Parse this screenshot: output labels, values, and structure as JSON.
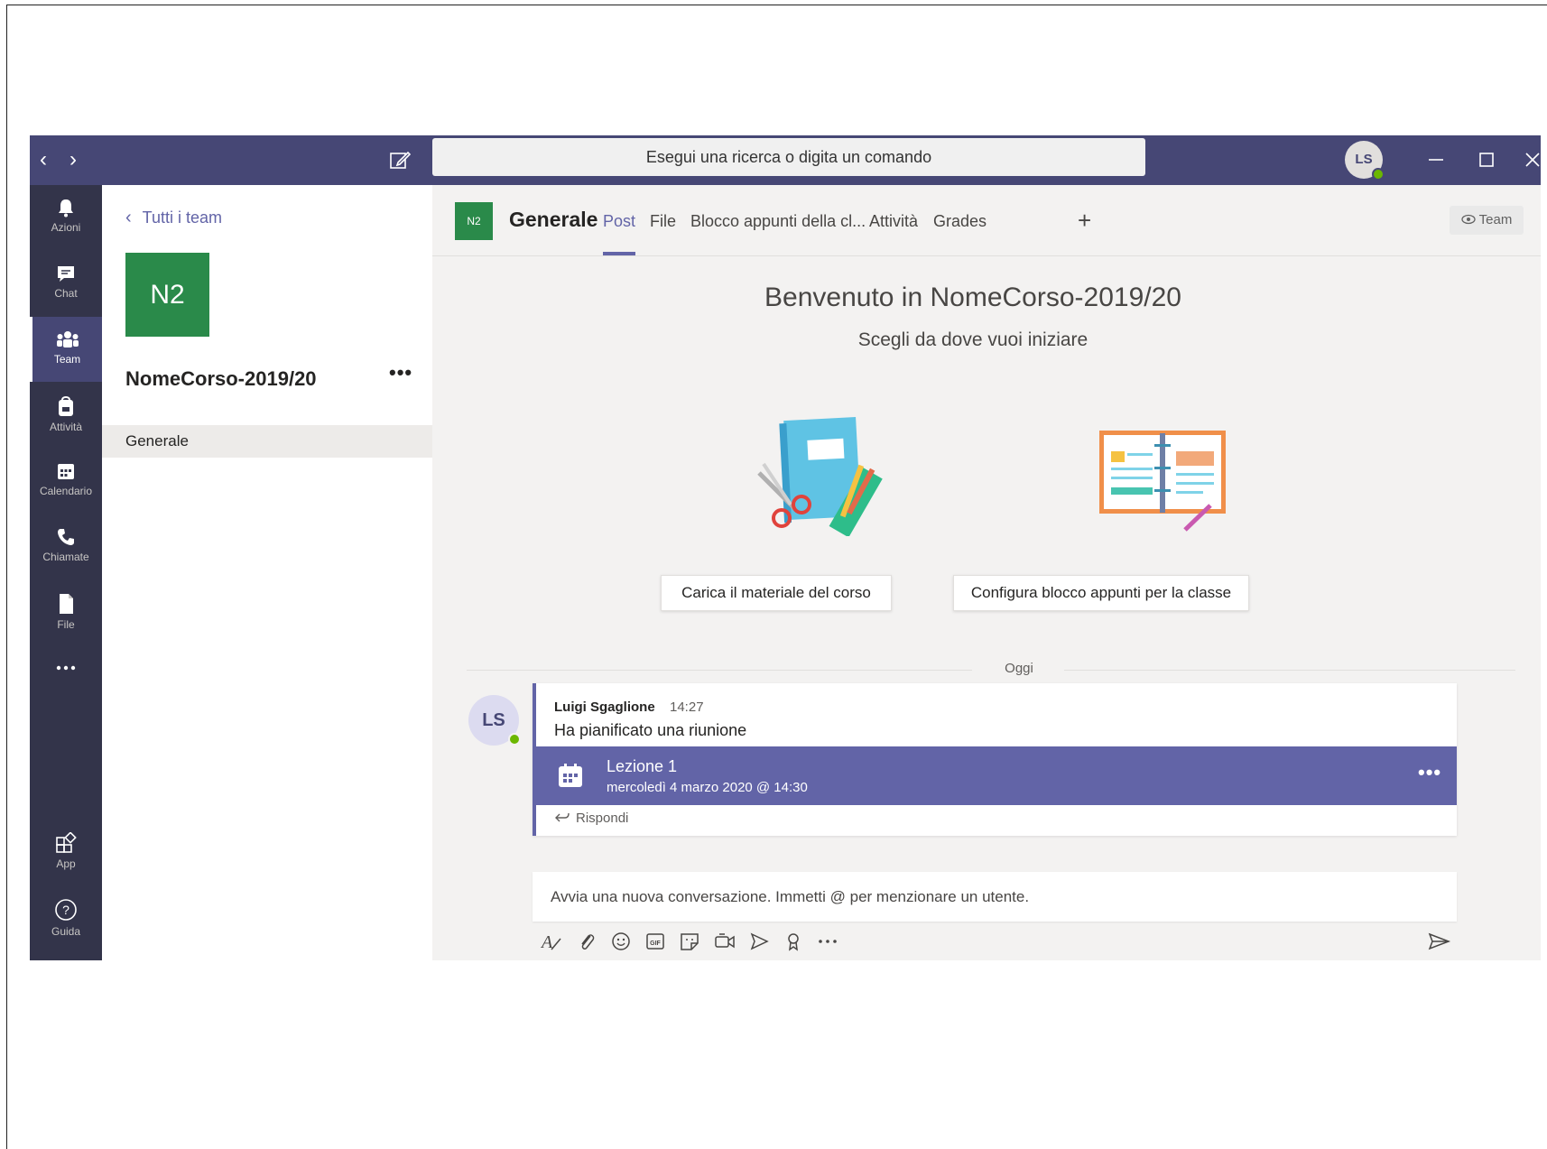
{
  "titlebar": {
    "search_placeholder": "Esegui una ricerca o digita un comando",
    "avatar_initials": "LS"
  },
  "rail": [
    {
      "label": "Azioni",
      "icon": "bell-icon"
    },
    {
      "label": "Chat",
      "icon": "chat-icon"
    },
    {
      "label": "Team",
      "icon": "teams-icon",
      "active": true
    },
    {
      "label": "Attività",
      "icon": "backpack-icon"
    },
    {
      "label": "Calendario",
      "icon": "calendar-icon"
    },
    {
      "label": "Chiamate",
      "icon": "phone-icon"
    },
    {
      "label": "File",
      "icon": "file-icon"
    },
    {
      "label": "App",
      "icon": "apps-icon"
    },
    {
      "label": "Guida",
      "icon": "help-icon"
    }
  ],
  "teampanel": {
    "back_label": "Tutti i team",
    "tile_initials": "N2",
    "team_name": "NomeCorso-2019/20",
    "channels": [
      "Generale"
    ]
  },
  "header": {
    "tile_initials": "N2",
    "channel_title": "Generale",
    "tabs": [
      "Post",
      "File",
      "Blocco appunti della cl...",
      "Attività",
      "Grades"
    ],
    "active_tab": "Post",
    "team_button": "Team"
  },
  "welcome": {
    "title": "Benvenuto in NomeCorso-2019/20",
    "subtitle": "Scegli da dove vuoi iniziare",
    "upload_button": "Carica il materiale del corso",
    "notebook_button": "Configura blocco appunti per la classe"
  },
  "divider": "Oggi",
  "message": {
    "avatar_initials": "LS",
    "author": "Luigi Sgaglione",
    "time": "14:27",
    "text": "Ha pianificato una riunione",
    "meeting_title": "Lezione 1",
    "meeting_date": "mercoledì 4 marzo 2020 @ 14:30",
    "reply_label": "Rispondi"
  },
  "compose": {
    "placeholder": "Avvia una nuova conversazione. Immetti @ per menzionare un utente."
  },
  "colors": {
    "accent": "#6264a7",
    "titlebar": "#464775",
    "rail": "#33344a",
    "team_tile": "#2a8a4a",
    "presence": "#6bb700"
  }
}
